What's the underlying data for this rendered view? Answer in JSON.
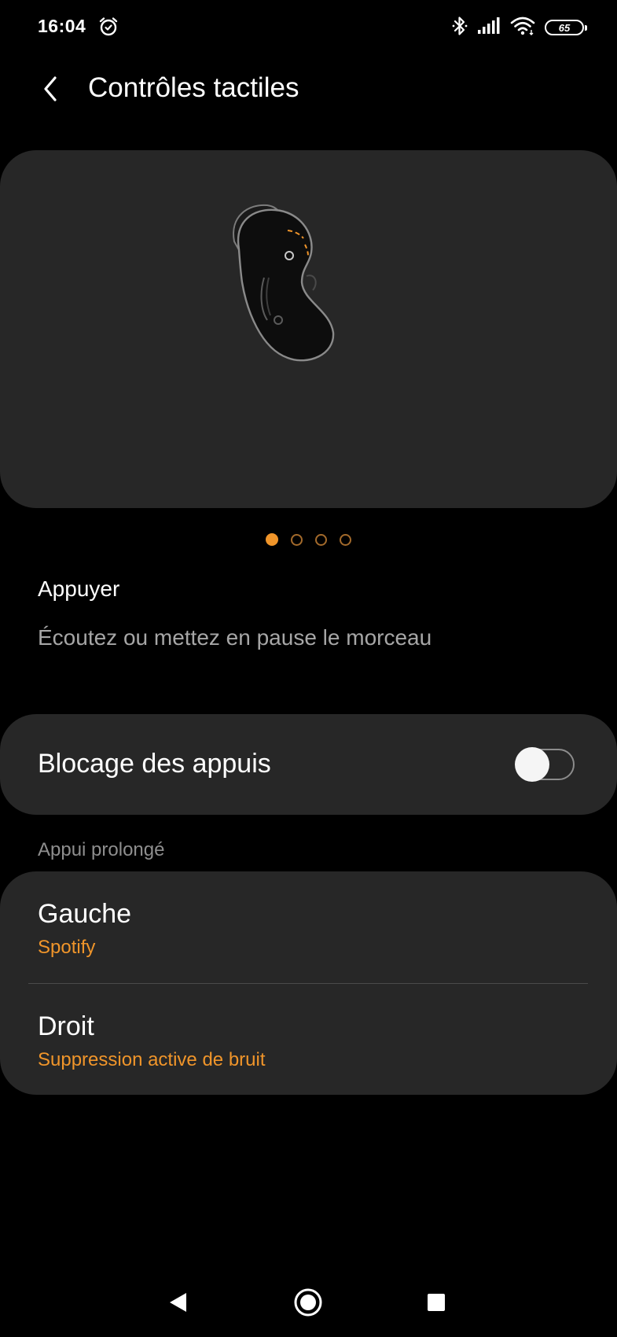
{
  "status_bar": {
    "time": "16:04",
    "battery_level": "65",
    "icons": [
      "alarm-icon",
      "bluetooth-icon",
      "signal-icon",
      "wifi-icon",
      "battery-icon"
    ]
  },
  "header": {
    "title": "Contrôles tactiles",
    "back_icon": "chevron-left-icon"
  },
  "illustration": {
    "icon": "earbud-illustration",
    "pager_count": 4,
    "pager_active_index": 0
  },
  "gesture": {
    "title": "Appuyer",
    "description": "Écoutez ou mettez en pause le morceau"
  },
  "touch_lock": {
    "label": "Blocage des appuis",
    "enabled": false
  },
  "long_press": {
    "section_title": "Appui prolongé",
    "items": [
      {
        "title": "Gauche",
        "value": "Spotify"
      },
      {
        "title": "Droit",
        "value": "Suppression active de bruit"
      }
    ]
  },
  "nav_bar": {
    "icons": [
      "nav-back-icon",
      "nav-home-icon",
      "nav-recents-icon"
    ]
  },
  "colors": {
    "background": "#000000",
    "card": "#272727",
    "accent": "#f0952a",
    "text_primary": "#ffffff",
    "text_secondary": "#a6a6a6"
  }
}
